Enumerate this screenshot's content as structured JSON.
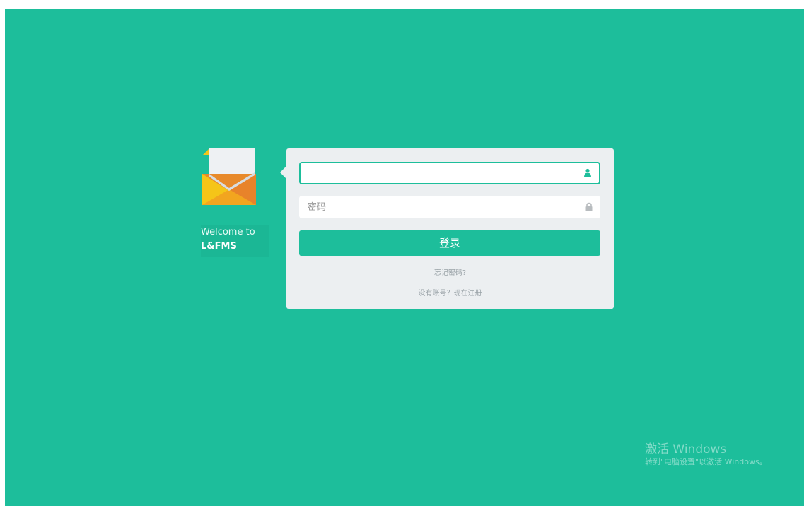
{
  "brand": {
    "welcome_text": "Welcome to",
    "app_name": "L&FMS",
    "logo_icon": "envelope-icon"
  },
  "login": {
    "username_value": "",
    "username_icon": "user-icon",
    "password_placeholder": "密码",
    "password_icon": "lock-icon",
    "submit_label": "登录",
    "forgot_password_link": "忘记密码?",
    "register_link": "没有账号？现在注册"
  },
  "watermark": {
    "line1": "激活 Windows",
    "line2": "转到\"电脑设置\"以激活 Windows。"
  },
  "colors": {
    "background": "#1dbe9b",
    "card": "#eceff1",
    "accent": "#1dbe9b",
    "envelope_yellow": "#f5c518",
    "envelope_orange": "#e8832a"
  }
}
